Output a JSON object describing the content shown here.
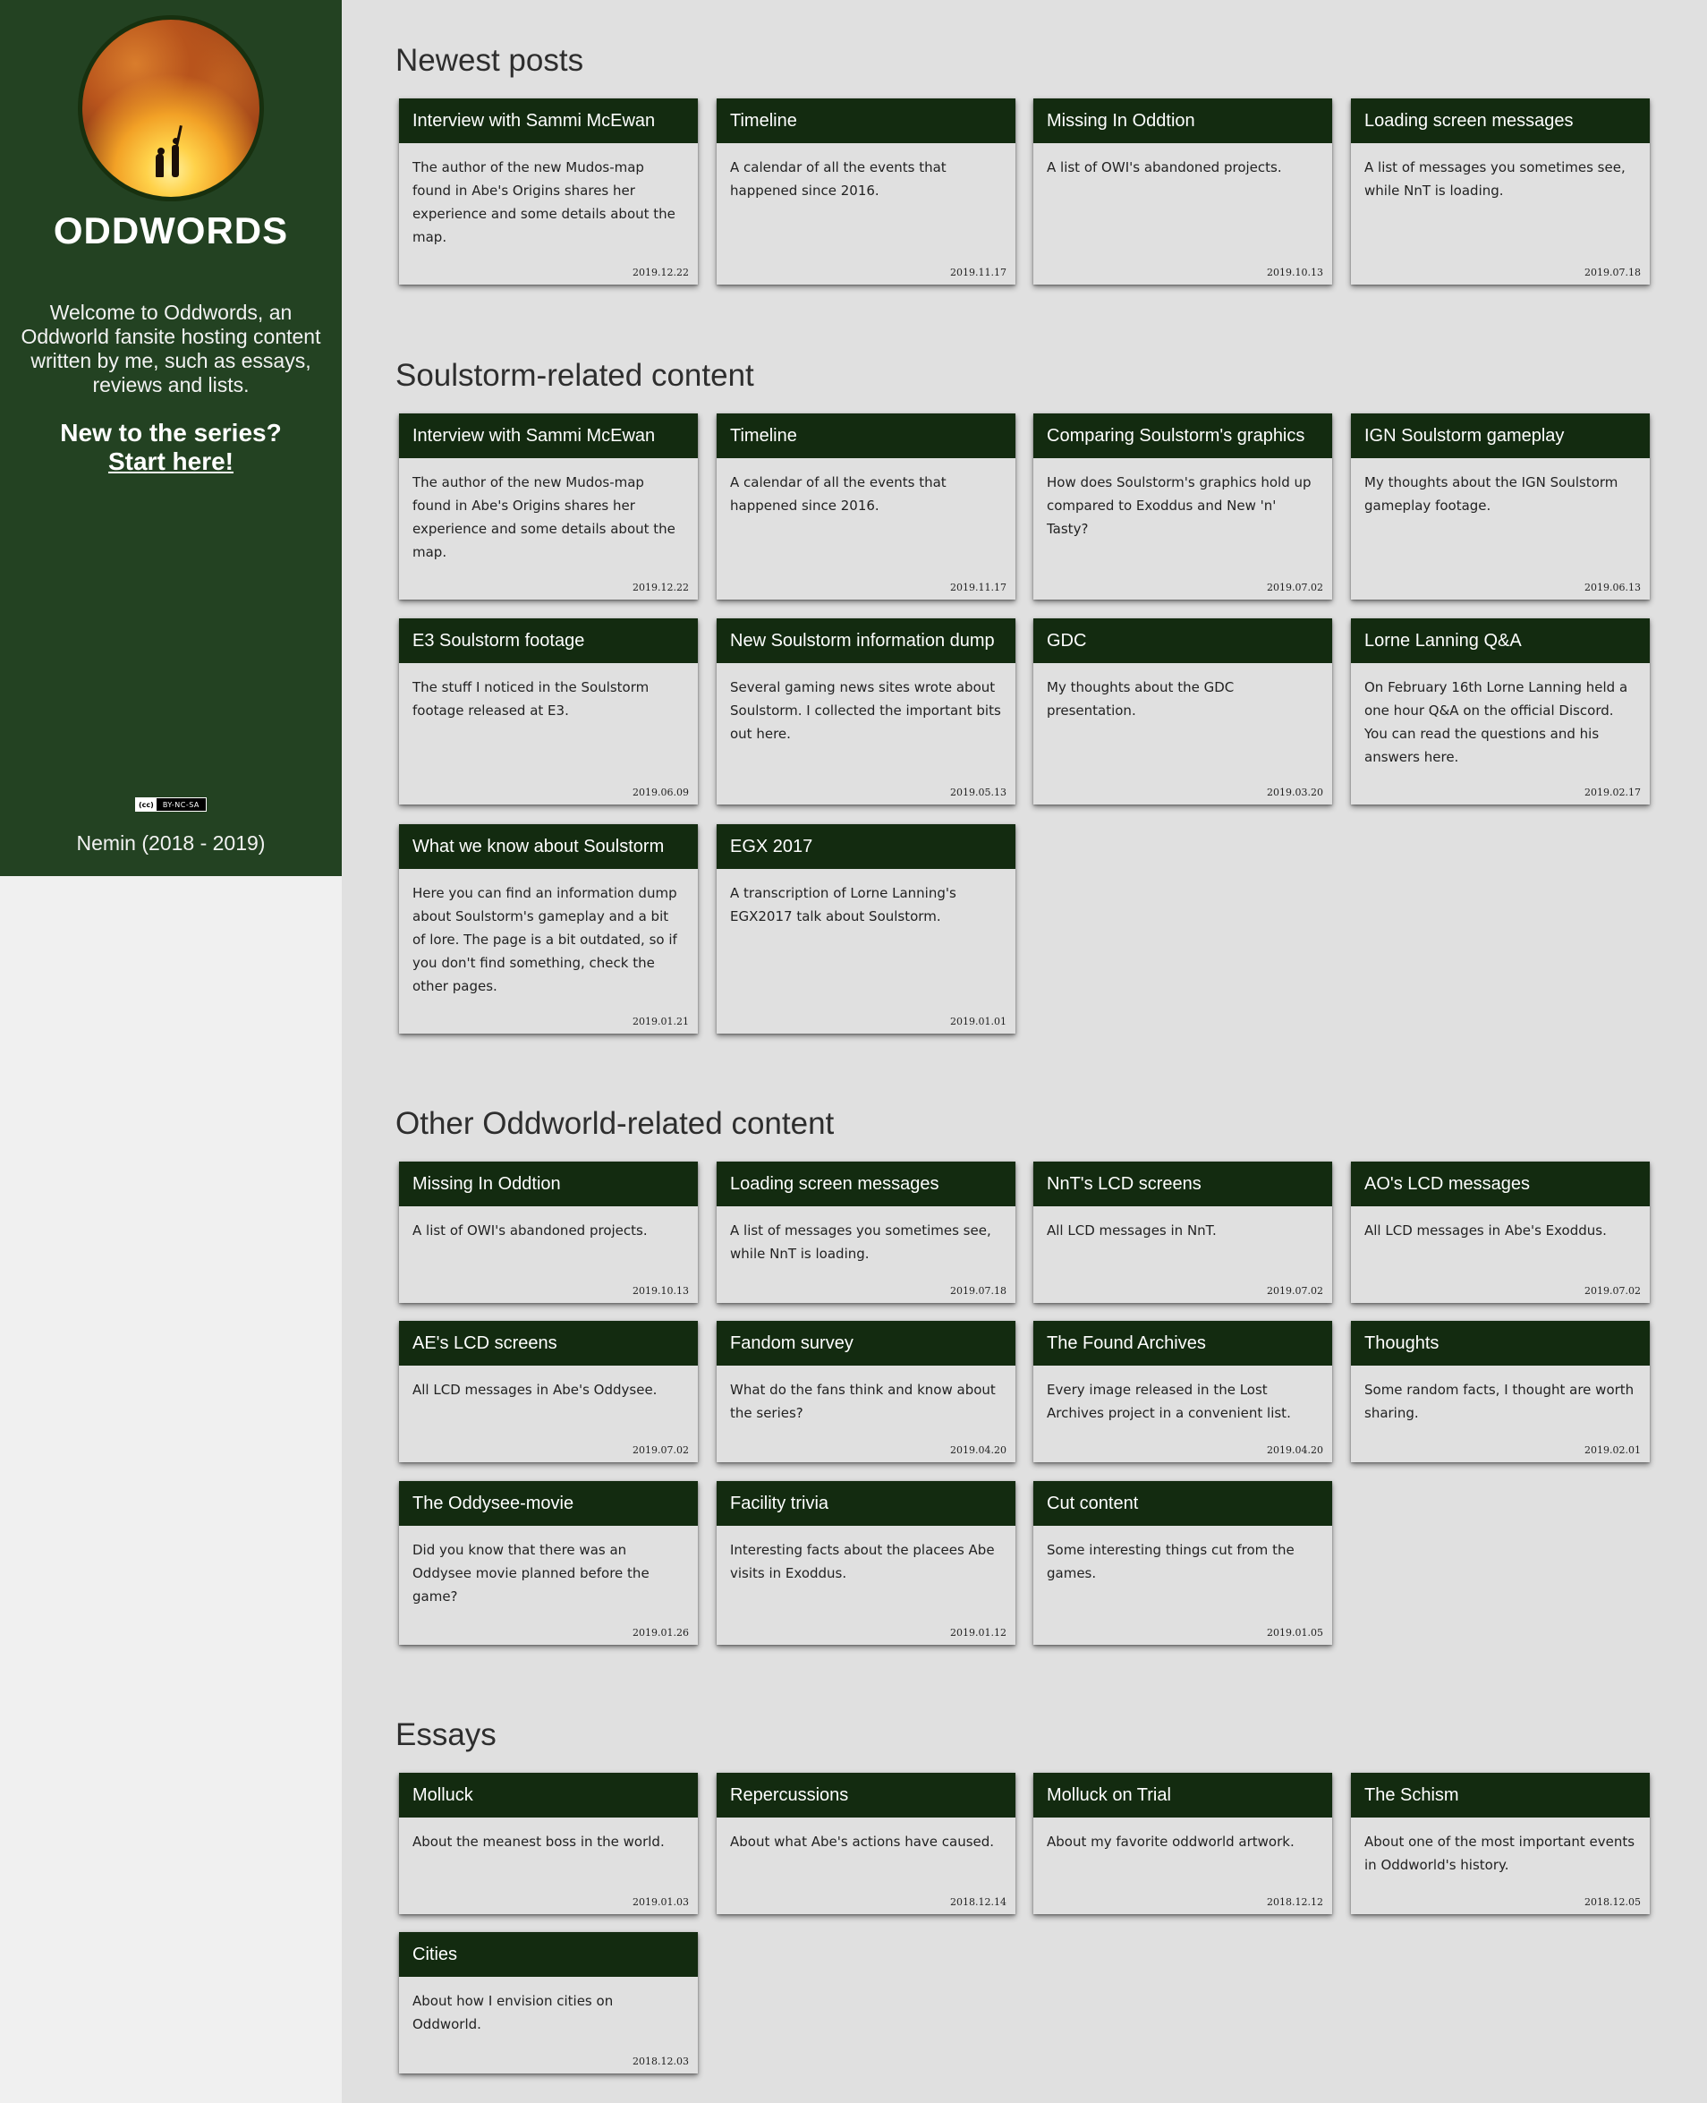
{
  "sidebar": {
    "site_title": "ODDWORDS",
    "welcome": "Welcome to Oddwords, an Oddworld fansite hosting content written by me, such as essays, reviews and lists.",
    "new_to_series": "New to the series?",
    "start_here": "Start here!",
    "license_cc": "(cc)",
    "license_text": "BY-NC-SA",
    "copyright": "Nemin (2018 - 2019)"
  },
  "sections": [
    {
      "title": "Newest posts",
      "cards": [
        {
          "title": "Interview with Sammi McEwan",
          "desc": "The author of the new Mudos-map found in Abe's Origins shares her experience and some details about the map.",
          "date": "2019.12.22"
        },
        {
          "title": "Timeline",
          "desc": "A calendar of all the events that happened since 2016.",
          "date": "2019.11.17"
        },
        {
          "title": "Missing In Oddtion",
          "desc": "A list of OWI's abandoned projects.",
          "date": "2019.10.13"
        },
        {
          "title": "Loading screen messages",
          "desc": "A list of messages you sometimes see, while NnT is loading.",
          "date": "2019.07.18"
        }
      ]
    },
    {
      "title": "Soulstorm-related content",
      "cards": [
        {
          "title": "Interview with Sammi McEwan",
          "desc": "The author of the new Mudos-map found in Abe's Origins shares her experience and some details about the map.",
          "date": "2019.12.22"
        },
        {
          "title": "Timeline",
          "desc": "A calendar of all the events that happened since 2016.",
          "date": "2019.11.17"
        },
        {
          "title": "Comparing Soulstorm's graphics",
          "desc": "How does Soulstorm's graphics hold up compared to Exoddus and New 'n' Tasty?",
          "date": "2019.07.02"
        },
        {
          "title": "IGN Soulstorm gameplay",
          "desc": "My thoughts about the IGN Soulstorm gameplay footage.",
          "date": "2019.06.13"
        },
        {
          "title": "E3 Soulstorm footage",
          "desc": "The stuff I noticed in the Soulstorm footage released at E3.",
          "date": "2019.06.09"
        },
        {
          "title": "New Soulstorm information dump",
          "desc": "Several gaming news sites wrote about Soulstorm. I collected the important bits out here.",
          "date": "2019.05.13"
        },
        {
          "title": "GDC",
          "desc": "My thoughts about the GDC presentation.",
          "date": "2019.03.20"
        },
        {
          "title": "Lorne Lanning Q&A",
          "desc": "On February 16th Lorne Lanning held a one hour Q&A on the official Discord. You can read the questions and his answers here.",
          "date": "2019.02.17"
        },
        {
          "title": "What we know about Soulstorm",
          "desc": "Here you can find an information dump about Soulstorm's gameplay and a bit of lore. The page is a bit outdated, so if you don't find something, check the other pages.",
          "date": "2019.01.21"
        },
        {
          "title": "EGX 2017",
          "desc": "A transcription of Lorne Lanning's EGX2017 talk about Soulstorm.",
          "date": "2019.01.01"
        }
      ]
    },
    {
      "title": "Other Oddworld-related content",
      "cards": [
        {
          "title": "Missing In Oddtion",
          "desc": "A list of OWI's abandoned projects.",
          "date": "2019.10.13"
        },
        {
          "title": "Loading screen messages",
          "desc": "A list of messages you sometimes see, while NnT is loading.",
          "date": "2019.07.18"
        },
        {
          "title": "NnT's LCD screens",
          "desc": "All LCD messages in NnT.",
          "date": "2019.07.02"
        },
        {
          "title": "AO's LCD messages",
          "desc": "All LCD messages in Abe's Exoddus.",
          "date": "2019.07.02"
        },
        {
          "title": "AE's LCD screens",
          "desc": "All LCD messages in Abe's Oddysee.",
          "date": "2019.07.02"
        },
        {
          "title": "Fandom survey",
          "desc": "What do the fans think and know about the series?",
          "date": "2019.04.20"
        },
        {
          "title": "The Found Archives",
          "desc": "Every image released in the Lost Archives project in a convenient list.",
          "date": "2019.04.20"
        },
        {
          "title": "Thoughts",
          "desc": "Some random facts, I thought are worth sharing.",
          "date": "2019.02.01"
        },
        {
          "title": "The Oddysee-movie",
          "desc": "Did you know that there was an Oddysee movie planned before the game?",
          "date": "2019.01.26"
        },
        {
          "title": "Facility trivia",
          "desc": "Interesting facts about the placees Abe visits in Exoddus.",
          "date": "2019.01.12"
        },
        {
          "title": "Cut content",
          "desc": "Some interesting things cut from the games.",
          "date": "2019.01.05"
        }
      ]
    },
    {
      "title": "Essays",
      "cards": [
        {
          "title": "Molluck",
          "desc": "About the meanest boss in the world.",
          "date": "2019.01.03"
        },
        {
          "title": "Repercussions",
          "desc": "About what Abe's actions have caused.",
          "date": "2018.12.14"
        },
        {
          "title": "Molluck on Trial",
          "desc": "About my favorite oddworld artwork.",
          "date": "2018.12.12"
        },
        {
          "title": "The Schism",
          "desc": "About one of the most important events in Oddworld's history.",
          "date": "2018.12.05"
        },
        {
          "title": "Cities",
          "desc": "About how I envision cities on Oddworld.",
          "date": "2018.12.03"
        }
      ]
    }
  ]
}
